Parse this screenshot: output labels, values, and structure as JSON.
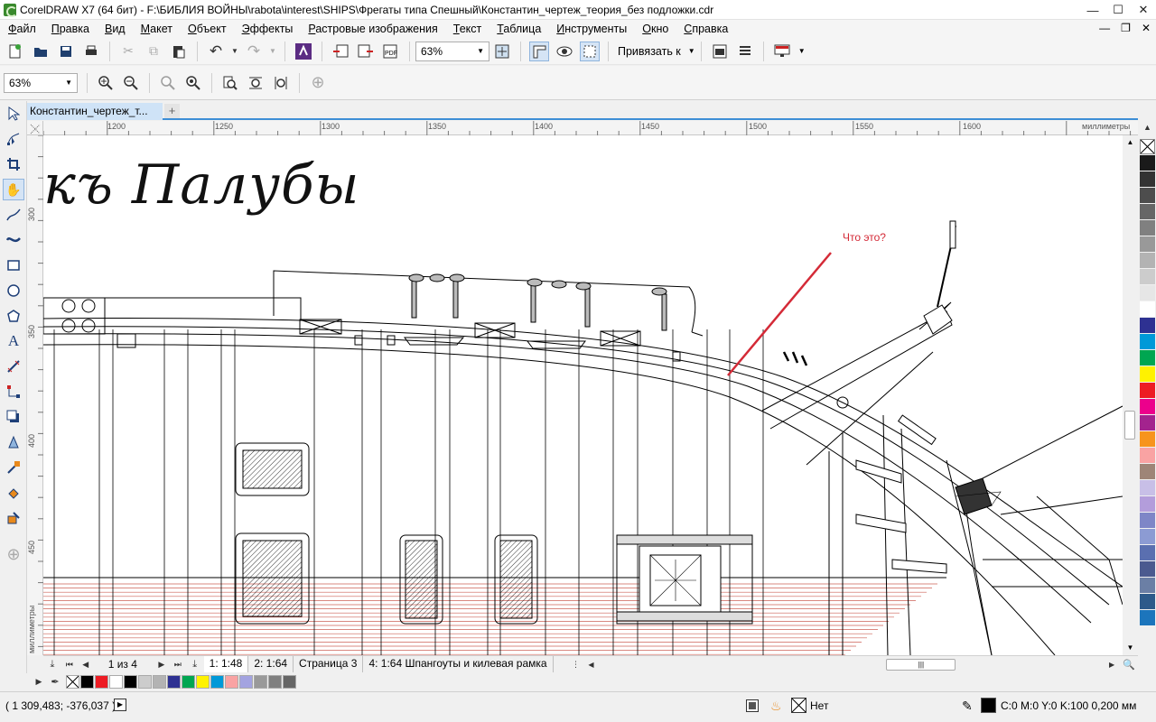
{
  "window": {
    "title": "CorelDRAW X7 (64 бит) - F:\\БИБЛИЯ ВОЙНЫ\\rabota\\interest\\SHIPS\\Фрегаты типа Спешный\\Константин_чертеж_теория_без подложки.cdr"
  },
  "menu": {
    "items": [
      "Файл",
      "Правка",
      "Вид",
      "Макет",
      "Объект",
      "Эффекты",
      "Растровые изображения",
      "Текст",
      "Таблица",
      "Инструменты",
      "Окно",
      "Справка"
    ]
  },
  "toolbar": {
    "zoom_value": "63%",
    "snap_label": "Привязать к"
  },
  "toolbar2": {
    "zoom_value": "63%"
  },
  "document": {
    "tab_label": "Константин_чертеж_т..."
  },
  "ruler": {
    "unit": "миллиметры",
    "h_ticks": [
      "1200",
      "1250",
      "1300",
      "1350",
      "1400",
      "1450",
      "1500",
      "1550",
      "1600"
    ],
    "v_ticks": [
      "300",
      "350",
      "400",
      "450"
    ],
    "v_unit": "миллиметры"
  },
  "canvas": {
    "heading_text": "къ Палубы",
    "annotation_text": "Что это?",
    "annotation_color": "#d42a37"
  },
  "page_nav": {
    "page_counter": "1 из 4",
    "tabs": [
      "1: 1:48",
      "2: 1:64",
      "Страница 3",
      "4: 1:64 Шпангоуты и килевая рамка"
    ]
  },
  "status": {
    "coordinates": "( 1 309,483; -376,037 )",
    "fill_label": "Нет",
    "outline_info": "C:0 M:0 Y:0 K:100  0,200 мм"
  },
  "palette_colors": [
    "#1a1a1a",
    "#333333",
    "#4d4d4d",
    "#666666",
    "#808080",
    "#999999",
    "#b3b3b3",
    "#cccccc",
    "#e6e6e6",
    "#ffffff",
    "#2e3192",
    "#0099d8",
    "#00a651",
    "#fff200",
    "#ed1c24",
    "#ec008c",
    "#a3238e",
    "#f7941d",
    "#f9a3a3",
    "#9e8577",
    "#c8bfe7",
    "#b39ddb",
    "#7e86c7",
    "#8c9bd3",
    "#5a6fb0",
    "#4b5a8f",
    "#6b7fa5",
    "#2d5a8a",
    "#1c75bc"
  ],
  "doc_palette_colors": [
    "#000000",
    "#ed1c24",
    "#ffffff",
    "#000000",
    "#cccccc",
    "#b3b3b3",
    "#2e3192",
    "#00a651",
    "#fff200",
    "#0099d8",
    "#f9a3a3",
    "#a3a3e0",
    "#999999",
    "#808080",
    "#666666"
  ]
}
